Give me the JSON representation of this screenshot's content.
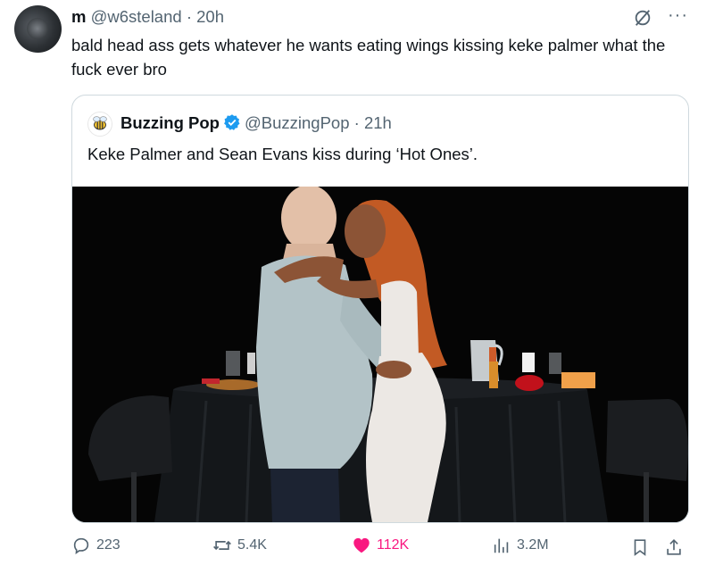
{
  "tweet": {
    "display_name": "m",
    "handle": "@w6steland",
    "separator": "·",
    "time": "20h",
    "text": "bald head ass gets whatever he wants eating wings kissing keke palmer what the fuck ever bro"
  },
  "quote": {
    "display_name": "Buzzing Pop",
    "handle": "@BuzzingPop",
    "separator": "·",
    "time": "21h",
    "text": "Keke Palmer and Sean Evans kiss during ‘Hot Ones’."
  },
  "actions": {
    "replies": "223",
    "reposts": "5.4K",
    "likes": "112K",
    "views": "3.2M"
  },
  "colors": {
    "like": "#f91880",
    "verified": "#1d9bf0",
    "secondary_text": "#536471"
  },
  "icons": [
    "grok-icon",
    "more-icon",
    "verified-badge-icon",
    "reply-icon",
    "repost-icon",
    "like-icon",
    "views-icon",
    "bookmark-icon",
    "share-icon"
  ]
}
